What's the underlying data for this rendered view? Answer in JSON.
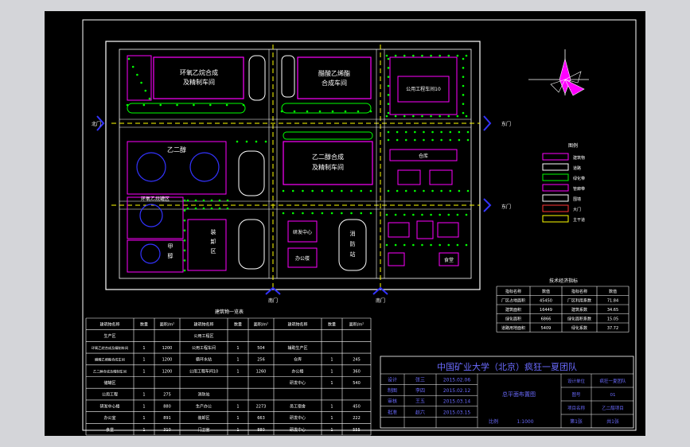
{
  "blocks": [
    {
      "id": "syn-workshop",
      "text": [
        "环氧乙烷合成",
        "及精制车间"
      ],
      "color": "#ffffff"
    },
    {
      "id": "acid-workshop",
      "text": [
        "醋酸乙烯酯",
        "合成车间"
      ],
      "color": "#ffffff"
    },
    {
      "id": "utility-10",
      "text": [
        "公用工程车间10"
      ],
      "color": "#ffffff"
    },
    {
      "id": "eg-workshop",
      "text": [
        "乙二醇合成",
        "及精制车间"
      ],
      "color": "#ffffff"
    },
    {
      "id": "eg-tank",
      "text": [
        "乙二醇"
      ],
      "color": "#ffffff"
    },
    {
      "id": "eg-tank2",
      "text": [
        "环氧乙烷罐区"
      ],
      "color": "#ffffff"
    },
    {
      "id": "methanol-tank",
      "text": [
        "甲",
        "醇"
      ],
      "color": "#ffffff"
    },
    {
      "id": "loading",
      "text": [
        "装",
        "卸",
        "区"
      ],
      "color": "#ffffff"
    },
    {
      "id": "office",
      "text": [
        "办公楼"
      ],
      "color": "#ffffff"
    },
    {
      "id": "lab",
      "text": [
        "研发中心"
      ],
      "color": "#ffffff"
    },
    {
      "id": "fire",
      "text": [
        "消",
        "防",
        "站"
      ],
      "color": "#ffffff"
    },
    {
      "id": "warehouse",
      "text": [
        "仓库"
      ],
      "color": "#ffffff"
    },
    {
      "id": "canteen",
      "text": [
        "食堂"
      ],
      "color": "#ffffff"
    },
    {
      "id": "gate-n",
      "text": [
        "北门"
      ],
      "color": "#ffffff"
    },
    {
      "id": "gate-e1",
      "text": [
        "东门"
      ],
      "color": "#ffffff"
    },
    {
      "id": "gate-e2",
      "text": [
        "东门"
      ],
      "color": "#ffffff"
    },
    {
      "id": "gate-s1",
      "text": [
        "南门"
      ],
      "color": "#ffffff"
    },
    {
      "id": "gate-s2",
      "text": [
        "南门"
      ],
      "color": "#ffffff"
    }
  ],
  "legend": {
    "title": "图例",
    "items": [
      "建筑物",
      "道路",
      "绿化带",
      "管廊带",
      "围墙",
      "大门",
      "主干道"
    ]
  },
  "stats": {
    "title": "技术经济指标",
    "headers": [
      "指标名称",
      "数值",
      "指标名称",
      "数值"
    ],
    "rows": [
      [
        "厂区占地面积",
        "45450",
        "厂区利用系数",
        "71.84"
      ],
      [
        "建筑面积",
        "16449",
        "建筑系数",
        "34.65"
      ],
      [
        "绿化面积",
        "6866",
        "绿化面积系数",
        "15.05"
      ],
      [
        "道路用地面积",
        "5409",
        "绿化系数",
        "37.72"
      ]
    ]
  },
  "building_table": {
    "title": "建筑物一览表",
    "headers": [
      "建筑物名称",
      "数量",
      "面积/m²",
      "建筑物名称",
      "数量",
      "面积/m²",
      "建筑物名称",
      "数量",
      "面积/m²"
    ],
    "rows": [
      [
        "生产区",
        "",
        "",
        "公用工程区",
        "",
        "",
        "",
        "",
        ""
      ],
      [
        "环氧乙烷合成及精制车间",
        "1",
        "1200",
        "公用工程车间",
        "1",
        "504",
        "辅助生产区",
        "",
        ""
      ],
      [
        "醋酸乙烯酯合成车间",
        "1",
        "1200",
        "循环水站",
        "1",
        "256",
        "仓库",
        "1",
        "245"
      ],
      [
        "乙二醇合成及精制车间",
        "1",
        "1200",
        "公用工程车间10",
        "1",
        "1260",
        "办公楼",
        "1",
        "360"
      ],
      [
        "储罐区",
        "",
        "",
        "",
        "",
        "",
        "研发中心",
        "1",
        "540"
      ],
      [
        "公用工程",
        "1",
        "275",
        "消防站",
        "",
        "",
        "",
        "",
        ""
      ],
      [
        "研发中心楼",
        "1",
        "880",
        "生产办公",
        "1",
        "2273",
        "员工宿舍",
        "1",
        "450"
      ],
      [
        "办公室",
        "1",
        "891",
        "装卸区",
        "1",
        "663",
        "研发中心",
        "1",
        "222"
      ],
      [
        "食堂",
        "1",
        "310",
        "门卫室",
        "1",
        "880",
        "研发中心",
        "1",
        "555"
      ]
    ]
  },
  "title_block": {
    "school": "中国矿业大学（北京）疯狂一夏团队",
    "drawing": "总平面布置图",
    "rows": [
      [
        "设计",
        "张三",
        "2015.02.06"
      ],
      [
        "制图",
        "李四",
        "2015.02.12"
      ],
      [
        "审核",
        "王五",
        "2015.03.14"
      ],
      [
        "批准",
        "赵六",
        "2015.03.15"
      ]
    ],
    "scale_label": "比例",
    "scale": "1:1000",
    "sheet": "第1张",
    "total": "共1张",
    "right_labels": [
      "设计单位",
      "图号",
      "项目名称"
    ],
    "right_values": [
      "疯狂一夏团队",
      "01",
      "乙二醇项目"
    ]
  },
  "colors": {
    "background": "#000000",
    "outer": "#d4d5d9",
    "road": "#ffff00",
    "wall": "#ffffff",
    "building": "#ff00ff",
    "green": "#00ff00",
    "gate": "#3333ff",
    "red": "#ff3333"
  }
}
